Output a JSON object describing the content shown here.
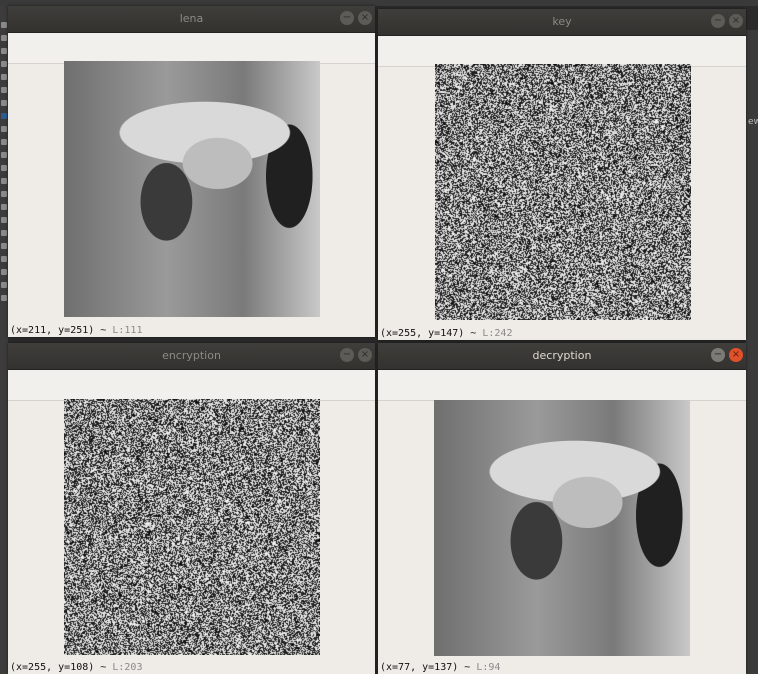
{
  "windows": {
    "lena": {
      "title": "lena",
      "status": {
        "coords": "(x=211, y=251) ~",
        "luminance": "L:111"
      }
    },
    "key": {
      "title": "key",
      "status": {
        "coords": "(x=255, y=147) ~",
        "luminance": "L:242"
      }
    },
    "encryption": {
      "title": "encryption",
      "status": {
        "coords": "(x=255, y=108) ~",
        "luminance": "L:203"
      }
    },
    "decryption": {
      "title": "decryption",
      "status": {
        "coords": "(x=77, y=137) ~",
        "luminance": "L:94"
      }
    }
  },
  "background": {
    "right_edge_text": "ew"
  },
  "icons": {
    "minimize": "minimize-icon",
    "close": "close-icon"
  },
  "colors": {
    "close_active": "#e0512a",
    "titlebar": "#3a3936",
    "window_body": "#efebe7"
  }
}
